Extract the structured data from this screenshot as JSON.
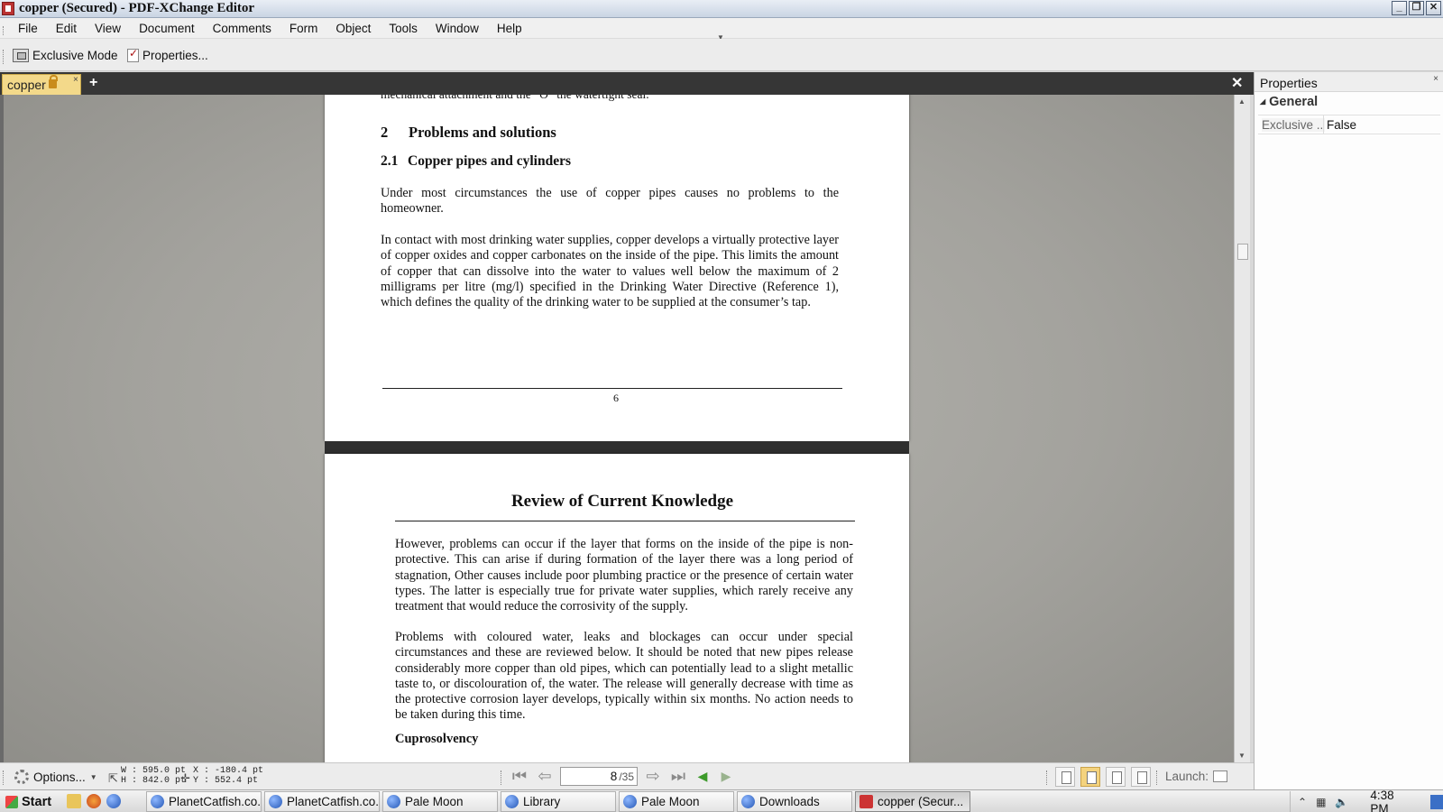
{
  "window": {
    "title": "copper (Secured) - PDF-XChange Editor",
    "controls": [
      "_",
      "❐",
      "✕"
    ]
  },
  "menu": [
    "File",
    "Edit",
    "View",
    "Document",
    "Comments",
    "Form",
    "Object",
    "Tools",
    "Window",
    "Help"
  ],
  "toolbar": {
    "exclusive_mode": "Exclusive Mode",
    "properties": "Properties..."
  },
  "tabs": {
    "doc_tab": "copper",
    "close": "×",
    "new_tab": "+",
    "strip_close": "✕"
  },
  "document": {
    "page1": {
      "cut_line": "mechanical attachment and the “O” the watertight seal.",
      "heading_num": "2",
      "heading": "Problems and solutions",
      "subheading_num": "2.1",
      "subheading": "Copper pipes and cylinders",
      "para1": "Under most circumstances the use of copper pipes causes no problems to the homeowner.",
      "para2": "In contact with most drinking water supplies, copper develops a virtually protective layer of copper oxides and copper carbonates on the inside of the pipe. This limits the amount of copper that can dissolve into the water to values well below the maximum of 2 milligrams per litre (mg/l) specified in the Drinking Water Directive (Reference 1), which defines the quality of the drinking water to be supplied at the consumer’s tap.",
      "page_number": "6"
    },
    "page2": {
      "title": "Review of Current Knowledge",
      "para1": "However, problems can occur if the layer that forms on the inside of the pipe is non-protective. This can arise if during formation of the layer there was a long period of stagnation, Other causes include poor plumbing practice or the presence of certain water types. The latter is especially true for private water supplies, which rarely receive any treatment that would reduce the corrosivity of the supply.",
      "para2": "Problems with coloured water, leaks and blockages can occur under special circumstances and these are reviewed below. It should be noted that new pipes release considerably more copper than old pipes, which can potentially lead to a slight metallic taste to, or discolouration of, the water. The release will generally decrease with time as the protective corrosion layer develops, typically within six months. No action needs to be taken during this time.",
      "subheading": "Cuprosolvency"
    }
  },
  "properties_panel": {
    "title": "Properties",
    "close": "×",
    "group": "General",
    "row_key": "Exclusive ..",
    "row_value": "False"
  },
  "statusbar": {
    "options": "Options...",
    "width": "W : 595.0 pt",
    "height": "H : 842.0 pt",
    "x": "X : -180.4 pt",
    "y": "Y :  552.4 pt",
    "current_page": "8",
    "total_pages": "/35",
    "launch": "Launch:"
  },
  "taskbar": {
    "start": "Start",
    "tasks": [
      "PlanetCatfish.co...",
      "PlanetCatfish.co...",
      "Pale Moon",
      "Library",
      "Pale Moon",
      "Downloads",
      "copper (Secur..."
    ],
    "clock": "4:38 PM"
  },
  "colors": {
    "active_tab": "#f3d98a",
    "tab_strip": "#363636",
    "doc_background": "#a3a29d"
  }
}
